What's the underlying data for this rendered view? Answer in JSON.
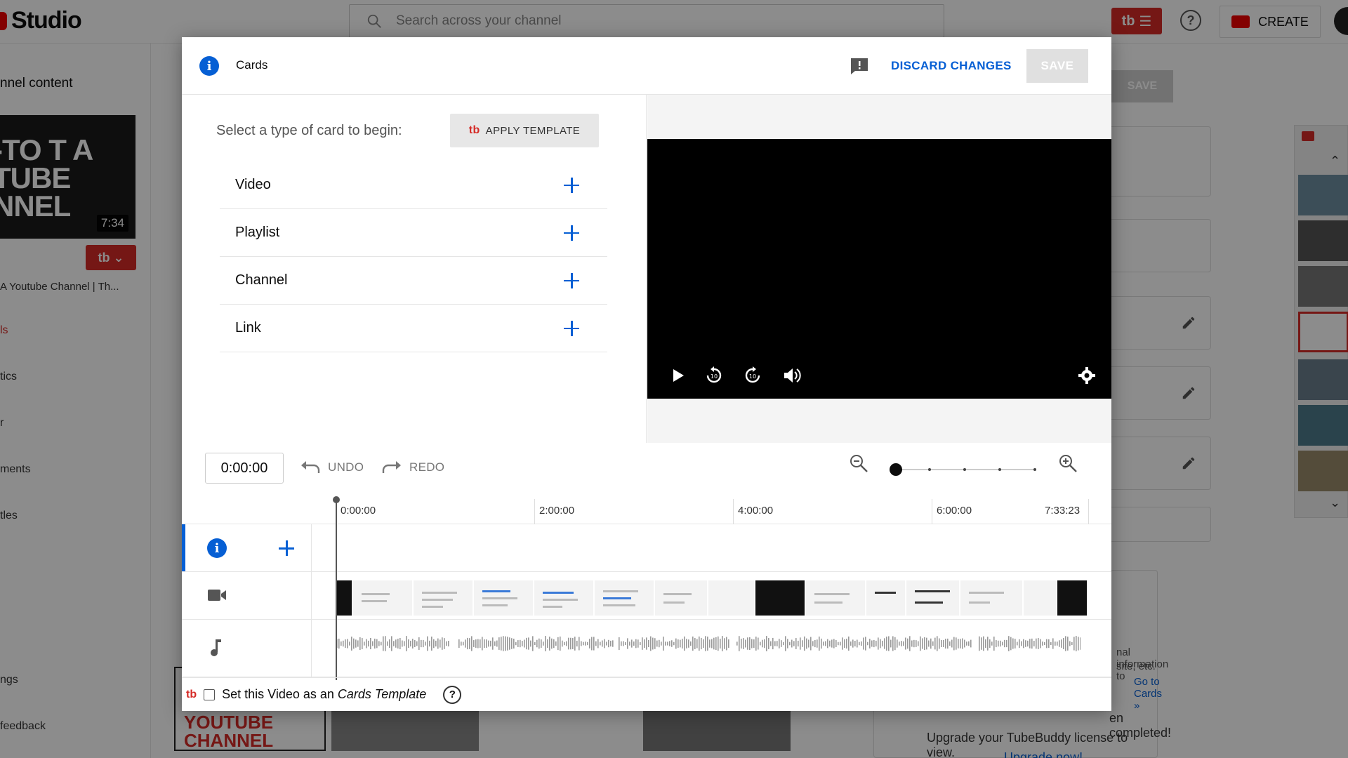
{
  "app": {
    "logo_text": "Studio",
    "search_placeholder": "Search across your channel",
    "tb_menu_label": "tb",
    "create_label": "CREATE"
  },
  "background": {
    "nav_heading": "nnel content",
    "thumb_text": "-TO T A TUBE NNEL",
    "thumb_duration": "7:34",
    "tb_chip": "tb",
    "video_title_partial": "A Youtube Channel | Th...",
    "nav_items": [
      "ls",
      "tics",
      "r",
      "ments",
      "tles",
      "ngs",
      "feedback"
    ],
    "save_label": "SAVE",
    "right_text_1": "nal information to",
    "right_text_2": "site, etc.",
    "go_to_cards": "Go to Cards »",
    "completed_text": "en completed!",
    "upgrade_text": "Upgrade your TubeBuddy license to view.",
    "upgrade_link": "Upgrade now!",
    "bottom_thumb_text": "YOUTUBE CHANNEL"
  },
  "modal": {
    "title": "Cards",
    "discard_label": "DISCARD CHANGES",
    "save_label": "SAVE",
    "select_prompt": "Select a type of card to begin:",
    "apply_template_label": "APPLY TEMPLATE",
    "tb_logo": "tb",
    "card_types": [
      "Video",
      "Playlist",
      "Channel",
      "Link"
    ],
    "timeline": {
      "current_time": "0:00:00",
      "undo_label": "UNDO",
      "redo_label": "REDO",
      "zoom_level": 0,
      "ticks": [
        "0:00:00",
        "2:00:00",
        "4:00:00",
        "6:00:00",
        "7:33:23"
      ]
    },
    "footer": {
      "tb_logo": "tb",
      "template_text_prefix": "Set this Video as an",
      "template_text_em": "Cards Template",
      "checkbox_checked": false
    }
  },
  "colors": {
    "accent_blue": "#065fd4",
    "tubebuddy_red": "#d52b27",
    "disabled_gray": "#e0e0e0"
  },
  "icons": {
    "search": "search-icon",
    "info": "info-icon",
    "feedback": "feedback-icon",
    "play": "play-icon",
    "rewind": "rewind-10-icon",
    "forward": "forward-10-icon",
    "volume": "volume-icon",
    "settings": "gear-icon",
    "undo": "undo-icon",
    "redo": "redo-icon",
    "zoom_out": "zoom-out-icon",
    "zoom_in": "zoom-in-icon",
    "add": "plus-icon",
    "video_track": "video-camera-icon",
    "audio_track": "music-note-icon",
    "help": "help-icon"
  }
}
